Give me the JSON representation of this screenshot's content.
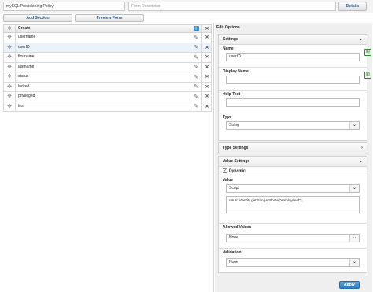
{
  "form": {
    "name_value": "mySQL Provisioning Policy",
    "description_placeholder": "Form Description",
    "details_label": "Details",
    "add_section_label": "Add Section",
    "preview_form_label": "Preview Form"
  },
  "grid": {
    "header_label": "Create",
    "rows": [
      "username",
      "userID",
      "firstname",
      "lastname",
      "status",
      "locked",
      "privileged",
      "test"
    ],
    "selected_row": "userID"
  },
  "edit_options": {
    "title": "Edit Options",
    "settings": {
      "title": "Settings",
      "name_label": "Name",
      "name_value": "userID",
      "display_name_label": "Display Name",
      "display_name_value": "",
      "help_text_label": "Help Text",
      "help_text_value": "",
      "type_label": "Type",
      "type_value": "String"
    },
    "type_settings": {
      "title": "Type Settings"
    },
    "value_settings": {
      "title": "Value Settings",
      "dynamic_label": "Dynamic",
      "dynamic_checked": true,
      "value_label": "Value",
      "value_type": "Script",
      "script_text": "return identity.getStringAttribute(\"employeeId\");",
      "allowed_values_label": "Allowed Values",
      "allowed_values_value": "None",
      "validation_label": "Validation",
      "validation_value": "None"
    },
    "apply_label": "Apply"
  }
}
